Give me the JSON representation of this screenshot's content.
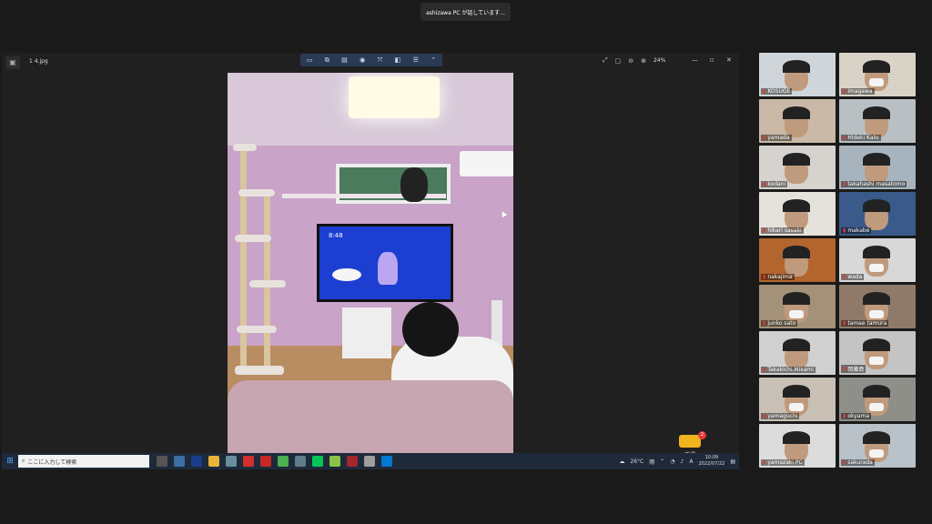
{
  "share_banner": "ashizawa  PC が話しています...",
  "viewer": {
    "file_name": "1 4.jpg",
    "zoom_level": "24%",
    "toolbar_icons": [
      "slideshow-icon",
      "crop-icon",
      "print-icon",
      "view-icon",
      "fit-icon",
      "compare-icon",
      "adjust-icon",
      "collapse-icon"
    ],
    "right_icons": [
      "fullscreen-icon",
      "fit-window-icon",
      "zoom-out-icon",
      "zoom-in-icon"
    ],
    "photo_tv_clock": "8:48"
  },
  "remote_control": {
    "name": "芦澤",
    "count": "2"
  },
  "taskbar": {
    "search_placeholder": "ここに入力して検索",
    "weather": "26°C",
    "weather_desc": "雨",
    "ime": "A",
    "time": "10:09",
    "date": "2022/07/22",
    "apps": [
      {
        "icon": "task-view-icon",
        "color": "#555555"
      },
      {
        "icon": "store-icon",
        "color": "#3a6ea5"
      },
      {
        "icon": "jw-icon",
        "color": "#1a3c8a"
      },
      {
        "icon": "explorer-icon",
        "color": "#e8b43a"
      },
      {
        "icon": "bird-icon",
        "color": "#6b8e9e"
      },
      {
        "icon": "acrobat-icon",
        "color": "#d32f2f"
      },
      {
        "icon": "pdf-icon",
        "color": "#c62828"
      },
      {
        "icon": "chrome-icon",
        "color": "#4caf50"
      },
      {
        "icon": "cloud-icon",
        "color": "#607d8b"
      },
      {
        "icon": "line-icon",
        "color": "#06c755"
      },
      {
        "icon": "maps-icon",
        "color": "#8bc34a"
      },
      {
        "icon": "access-icon",
        "color": "#a4262c"
      },
      {
        "icon": "ime-icon",
        "color": "#9e9e9e"
      },
      {
        "icon": "photos-icon",
        "color": "#0078d4"
      }
    ]
  },
  "participants": [
    {
      "name": "KOSUGE",
      "mask": false,
      "bg": "#cfd5d8"
    },
    {
      "name": "imagawa",
      "mask": true,
      "bg": "#d9d3c7"
    },
    {
      "name": "yamada",
      "mask": false,
      "bg": "#c9b9a6"
    },
    {
      "name": "Hideki Kato",
      "mask": false,
      "bg": "#b9c0c4"
    },
    {
      "name": "kodani",
      "mask": false,
      "bg": "#d6d3ce"
    },
    {
      "name": "takahashi masatomo",
      "mask": false,
      "bg": "#a8b4bd"
    },
    {
      "name": "hikari sasaki",
      "mask": false,
      "bg": "#e5e2dc"
    },
    {
      "name": "makabe",
      "mask": false,
      "bg": "#3a5a8a"
    },
    {
      "name": "nakajima",
      "mask": false,
      "bg": "#b3652e"
    },
    {
      "name": "wada",
      "mask": true,
      "bg": "#d8d8d8"
    },
    {
      "name": "junko sato",
      "mask": true,
      "bg": "#a49278"
    },
    {
      "name": "tamae tamura",
      "mask": true,
      "bg": "#8f7a6a"
    },
    {
      "name": "Takakichi.Mikami",
      "mask": false,
      "bg": "#d0d0d0"
    },
    {
      "name": "岡藤貢",
      "mask": true,
      "bg": "#c4c4c4"
    },
    {
      "name": "yamaguchi",
      "mask": true,
      "bg": "#c9c0b5"
    },
    {
      "name": "okyama",
      "mask": true,
      "bg": "#8d8f88"
    },
    {
      "name": "yamazaki PC",
      "mask": false,
      "bg": "#dcdcdc"
    },
    {
      "name": "sakurada",
      "mask": true,
      "bg": "#b8c2c8"
    }
  ]
}
